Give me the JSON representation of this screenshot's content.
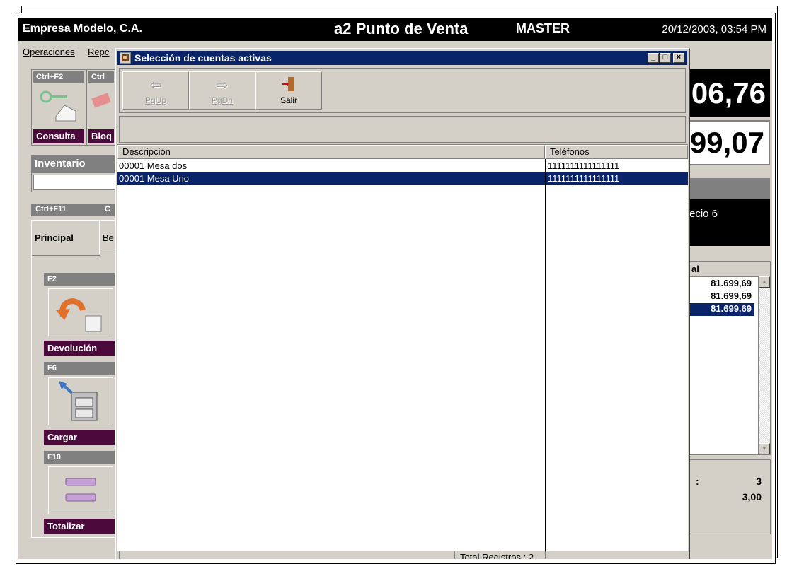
{
  "app": {
    "company": "Empresa Modelo, C.A.",
    "product": "a2 Punto de Venta",
    "user": "MASTER",
    "datetime": "20/12/2003, 03:54 PM"
  },
  "menu": {
    "item1": "Operaciones",
    "item2": "Repc"
  },
  "top_keys": [
    {
      "key": "Ctrl+F2",
      "caption": "Consulta"
    },
    {
      "key": "Ctrl",
      "caption": "Bloq"
    }
  ],
  "inventory": {
    "title": "Inventario"
  },
  "tabs": {
    "ctrl_f11": "Ctrl+F11",
    "c": "C",
    "principal": "Principal",
    "be": "Be"
  },
  "side_keys": [
    {
      "key": "F2",
      "caption": "Devolución",
      "icon": "return-arrow-icon"
    },
    {
      "key": "F6",
      "caption": "Cargar",
      "icon": "cabinet-icon"
    },
    {
      "key": "F10",
      "caption": "Totalizar",
      "icon": "bars-icon"
    }
  ],
  "right_panel": {
    "amount1": "06,76",
    "amount2": "99,07",
    "precio": "ecio 6",
    "grid_header": "al",
    "grid_rows": [
      "81.699,69",
      "81.699,69",
      "81.699,69"
    ],
    "count_sep": ":",
    "count": "3",
    "qty": "3,00"
  },
  "dialog": {
    "title": "Selección de cuentas activas",
    "toolbar": {
      "pgup": "PgUp",
      "pgdn": "PgDn",
      "salir": "Salir"
    },
    "columns": {
      "descripcion": "Descripción",
      "telefonos": "Teléfonos"
    },
    "rows": [
      {
        "desc": "00001 Mesa dos",
        "tel": "1111111111111111"
      },
      {
        "desc": "00001 Mesa Uno",
        "tel": "1111111111111111"
      }
    ],
    "status": "Total Registros : 2"
  }
}
